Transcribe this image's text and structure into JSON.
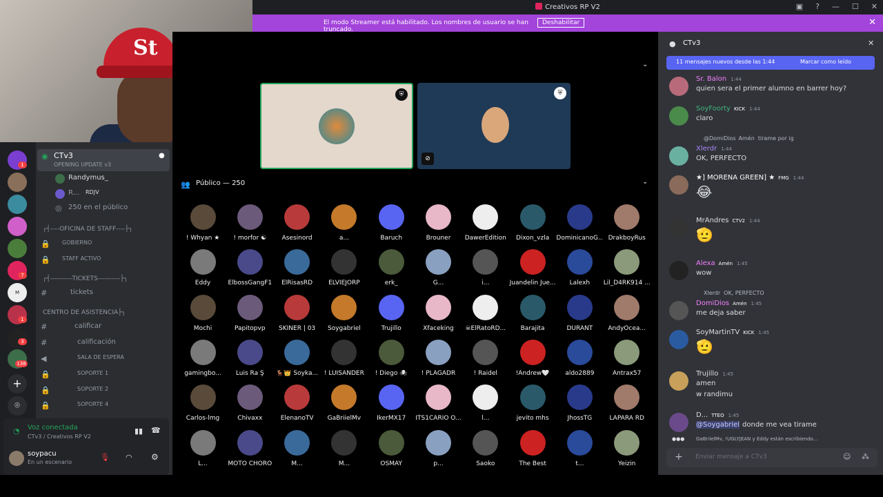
{
  "window": {
    "title": "Creativos RP V2"
  },
  "streamer": {
    "message": "El modo Streamer está habilitado. Los nombres de usuario se han truncado.",
    "button": "Deshabilitar"
  },
  "guild_badges": [
    "1",
    "1",
    "7",
    "1",
    "3",
    "138"
  ],
  "channels": {
    "current": {
      "name": "CTv3",
      "subtitle": "OPENING UPDATE v3"
    },
    "stage_users": [
      "Randymus_",
      "R...",
      "RDJV"
    ],
    "audience_count": "250 en el público",
    "cat1": "┌┤----OFICINA DE STAFF----├┐",
    "gobierno": "GOBIERNO",
    "staff_activo": "STAFF ACTIVO",
    "cat2": "┌┤----------TICKETS----------├┐",
    "tickets": "tickets",
    "cat3": "CENTRO DE ASISTENCIA├┐",
    "calificar": "calificar",
    "calificacion": "calificación",
    "sala": "SALA DE ESPERA",
    "soporte1": "SOPORTE 1",
    "soporte2": "SOPORTE 2",
    "soporte4": "SOPORTE 4"
  },
  "voice": {
    "status": "Voz conectada",
    "location": "CTv3 / Creativos RP V2",
    "user": "soypacu",
    "user_status": "En un escenario"
  },
  "stage": {
    "audience_header": "Público — 250"
  },
  "audience": [
    [
      "! Whyan ★",
      "! morfor ☯",
      "Asesinord",
      "a...",
      "Baruch",
      "Brouner",
      "DawerEdition",
      "Dixon_vzla",
      "DominicanoG...",
      "DrakboyRus"
    ],
    [
      "Eddy",
      "ElbossGangF1",
      "ElRisasRD",
      "ELVIEJORP",
      "erk_",
      "G...",
      "i...",
      "Juandelin Jue...",
      "Lalexh",
      "Lil_D4RK914 ..."
    ],
    [
      "Mochi",
      "Papitopvp",
      "SKINER | 03",
      "Soygabriel",
      "Trujillo",
      "Xfaceking",
      "☠ElRatoRD...",
      "Barajita",
      "DURANT",
      "AndyOcea..."
    ],
    [
      "gamingbo...",
      "Luis Ra Ş",
      "🦌👑 Soyka...",
      "! LUISANDER",
      "! Diego 🕷",
      "! PLAGADR",
      "! Raidel",
      "!Andrew🤍",
      "aldo2889",
      "Antrax57"
    ],
    [
      "Carlos-lmg",
      "Chivaxx",
      "ElenanoTV",
      "GaBriielMv",
      "IkerMX17",
      "ITS1CARIO O...",
      "l...",
      "jevito mhs",
      "JhossTG",
      "LAPARA RD"
    ],
    [
      "L...",
      "MOTO CHORO",
      "M...",
      "M...",
      "OSMAY",
      "p...",
      "Saoko",
      "The Best",
      "t...",
      "Yeizin"
    ]
  ],
  "chat": {
    "channel": "CTv3",
    "banner": "11 mensajes nuevos desde las 1:44",
    "mark_read": "Marcar como leído",
    "messages": [
      {
        "name": "Sr. Balon",
        "time": "1:44",
        "text": "quien sera el primer alumno en barrer hoy?"
      },
      {
        "name": "SoyFoorty",
        "badge": "KICK",
        "time": "1:44",
        "text": "claro"
      },
      {
        "reply": "@DomiDios",
        "reply_badge": "Amén",
        "reply_text": "tirame por ig",
        "name": "Xlerdr",
        "time": "1:44",
        "text": "OK, PERFECTO"
      },
      {
        "name": "★] MORENA GREEN] ★",
        "badge": "FMG",
        "time": "1:44",
        "text": "😂"
      },
      {
        "name": "MrAndres",
        "badge": "CTV2",
        "time": "1:44",
        "text": "🫡"
      },
      {
        "name": "Alexa",
        "badge": "Amén",
        "time": "1:45",
        "text": "wow"
      },
      {
        "reply": "Xlerdr",
        "reply_text": "OK, PERFECTO",
        "name": "DomiDios",
        "badge": "Amén",
        "time": "1:45",
        "text": "me deja saber"
      },
      {
        "name": "SoyMartinTV",
        "badge": "KICK",
        "time": "1:45",
        "text": "🫡"
      },
      {
        "name": "Trujillo",
        "time": "1:45",
        "text": "amen",
        "text2": "w randimu"
      },
      {
        "name": "D...",
        "badge": "TTEO",
        "time": "1:45",
        "mention": "@Soygabriel",
        "text": "donde me vea tirame"
      }
    ],
    "typing": "GaBriielMv, !UGLYJEAN y Eddy están escribiendo...",
    "input_placeholder": "Enviar mensaje a CTv3"
  },
  "colors": {
    "brand": "#5865f2",
    "streamer": "#a344db",
    "green": "#23a55a"
  }
}
